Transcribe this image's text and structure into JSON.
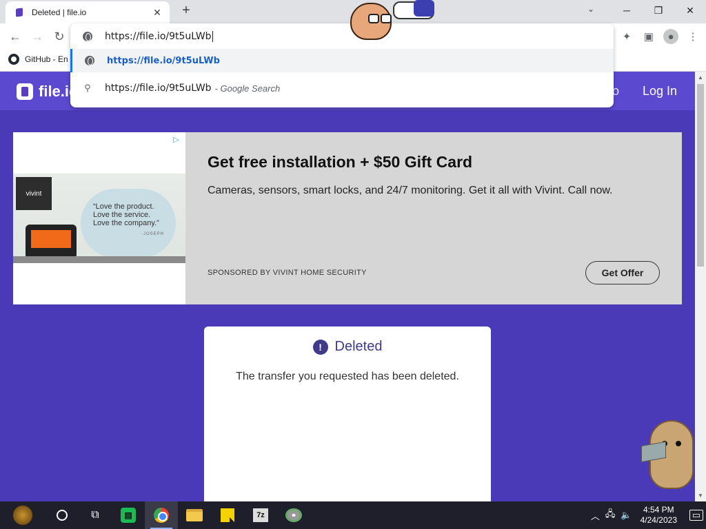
{
  "browser": {
    "tab_title": "Deleted | file.io",
    "tab_close": "✕",
    "new_tab": "+",
    "address_text": "https://file.io/9t5uLWb",
    "bookmark_label": "GitHub - En"
  },
  "omnibox": {
    "suggestion_url": "https://file.io/9t5uLWb",
    "search_query": "https://file.io/9t5uLWb",
    "search_suffix": "- Google Search"
  },
  "site": {
    "logo_text": "file.io",
    "nav_partial": "o",
    "login_label": "Log In"
  },
  "ad": {
    "brand_badge": "vivint",
    "quote_lines": [
      "“Love the product.",
      "Love the service.",
      "Love the company.”"
    ],
    "quote_by": "-JOSEPH",
    "headline": "Get free installation + $50 Gift Card",
    "description": "Cameras, sensors, smart locks, and 24/7 monitoring. Get it all with Vivint. Call now.",
    "sponsor": "SPONSORED BY VIVINT HOME SECURITY",
    "cta": "Get Offer"
  },
  "status_card": {
    "title": "Deleted",
    "icon_glyph": "!",
    "message": "The transfer you requested has been deleted."
  },
  "taskbar": {
    "app_7z_label": "7z",
    "clock_time": "4:54 PM",
    "clock_date": "4/24/2023"
  },
  "colors": {
    "page_bg": "#4a3ab8",
    "accent": "#3f3a8a",
    "link": "#1a5fc4"
  }
}
